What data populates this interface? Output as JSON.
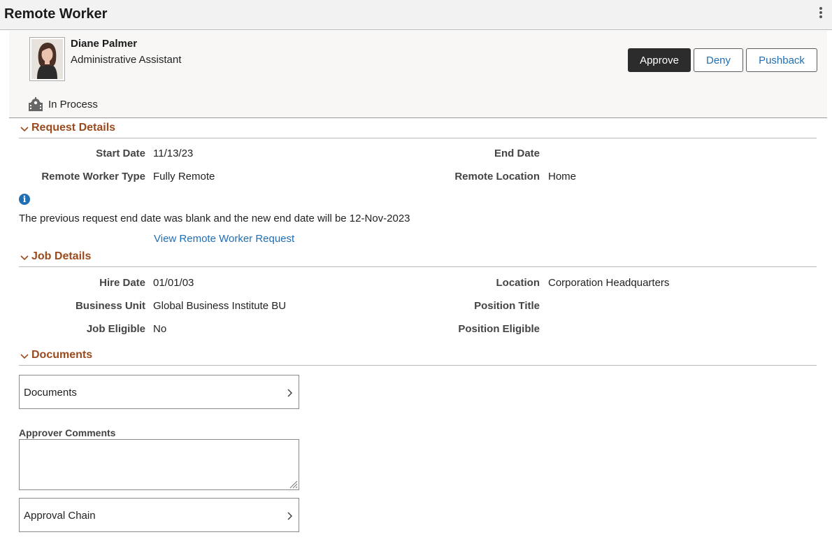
{
  "window": {
    "title": "Remote Worker"
  },
  "employee": {
    "name": "Diane Palmer",
    "job_title": "Administrative Assistant",
    "photo_icon": "employee-photo"
  },
  "actions": {
    "approve": "Approve",
    "deny": "Deny",
    "pushback": "Pushback"
  },
  "status": {
    "text": "In Process",
    "icon": "gear-calendar-icon"
  },
  "request_details": {
    "title": "Request Details",
    "start_date_label": "Start Date",
    "start_date": "11/13/23",
    "end_date_label": "End Date",
    "end_date": "",
    "remote_type_label": "Remote Worker Type",
    "remote_type": "Fully Remote",
    "remote_location_label": "Remote Location",
    "remote_location": "Home",
    "info_message": "The previous request end date was blank and the new end date will be 12-Nov-2023",
    "view_link": "View Remote Worker Request"
  },
  "job_details": {
    "title": "Job Details",
    "hire_date_label": "Hire Date",
    "hire_date": "01/01/03",
    "location_label": "Location",
    "location": "Corporation Headquarters",
    "business_unit_label": "Business Unit",
    "business_unit": "Global Business Institute BU",
    "position_title_label": "Position Title",
    "position_title": "",
    "job_eligible_label": "Job Eligible",
    "job_eligible": "No",
    "position_eligible_label": "Position Eligible",
    "position_eligible": ""
  },
  "documents": {
    "title": "Documents",
    "nav_label": "Documents"
  },
  "approver_comments": {
    "label": "Approver Comments",
    "value": ""
  },
  "approval_chain": {
    "label": "Approval Chain"
  },
  "colors": {
    "section_title": "#9a4a1d",
    "link": "#1f6fb5",
    "primary_button": "#2c2c2c"
  }
}
